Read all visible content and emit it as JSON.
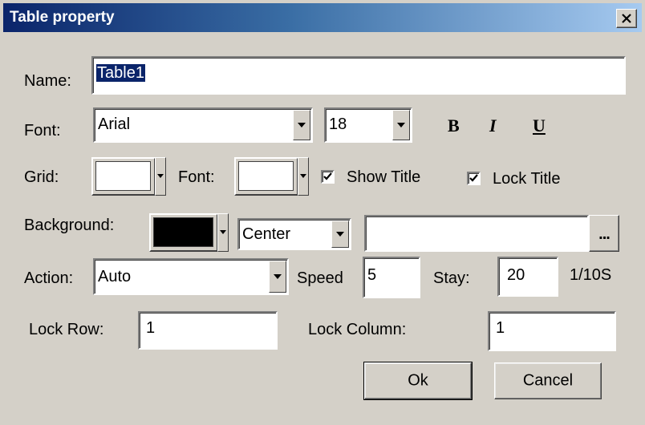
{
  "window": {
    "title": "Table property"
  },
  "name": {
    "label": "Name:",
    "value": "Table1"
  },
  "font_row": {
    "label": "Font:",
    "font_value": "Arial",
    "size_value": "18",
    "bold_label": "B",
    "italic_label": "I",
    "underline_label": "U"
  },
  "grid_row": {
    "grid_label": "Grid:",
    "grid_color": "#ffffff",
    "font_label": "Font:",
    "font_color": "#ffffff",
    "show_title_label": "Show Title",
    "show_title_checked": true,
    "lock_title_label": "Lock Title",
    "lock_title_checked": true
  },
  "background_row": {
    "label": "Background:",
    "color": "#000000",
    "align_value": "Center",
    "image_path": "",
    "browse_label": "..."
  },
  "action_row": {
    "label": "Action:",
    "value": "Auto",
    "speed_label": "Speed",
    "speed_value": "5",
    "stay_label": "Stay:",
    "stay_value": "20",
    "unit_label": "1/10S"
  },
  "lock_row": {
    "row_label": "Lock Row:",
    "row_value": "1",
    "column_label": "Lock Column:",
    "column_value": "1"
  },
  "buttons": {
    "ok": "Ok",
    "cancel": "Cancel"
  }
}
